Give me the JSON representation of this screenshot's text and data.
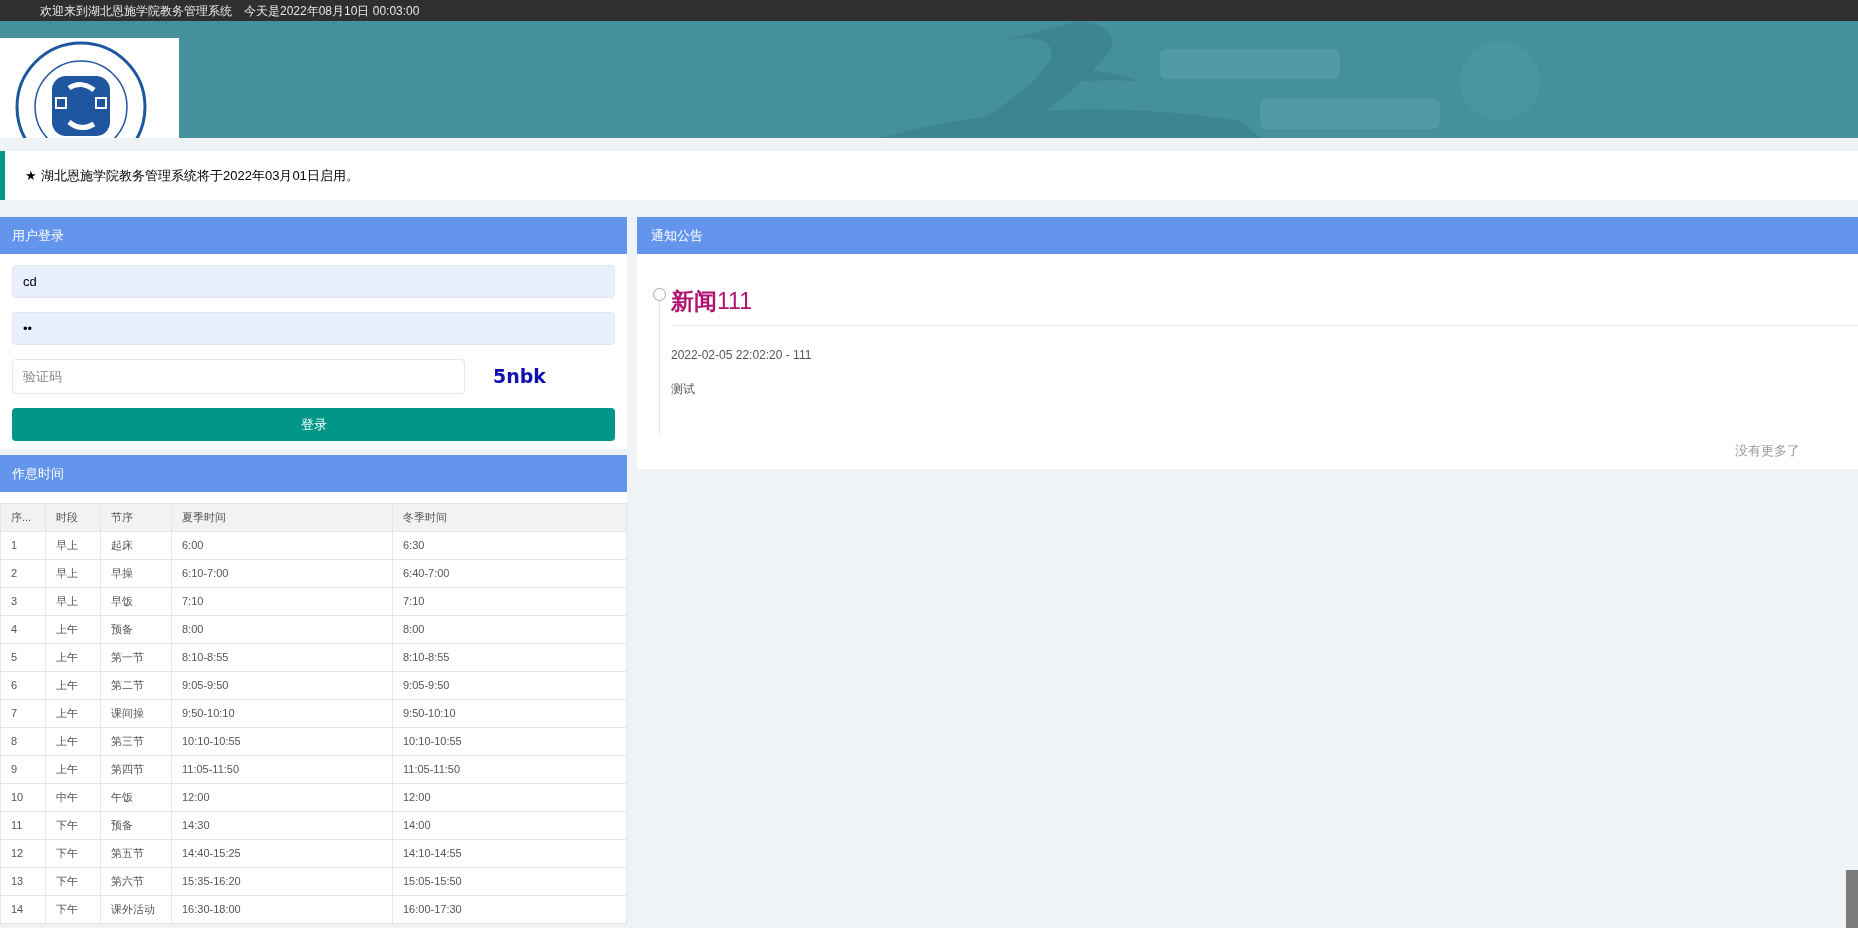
{
  "top_bar": {
    "welcome": "欢迎来到湖北恩施学院教务管理系统",
    "date_text": "今天是2022年08月10日 00:03:00"
  },
  "notice": {
    "icon": "★",
    "text": "湖北恩施学院教务管理系统将于2022年03月01日启用。"
  },
  "login": {
    "title": "用户登录",
    "username": {
      "value": "cd"
    },
    "password": {
      "value": "••"
    },
    "captcha": {
      "placeholder": "验证码",
      "code": "5nbk"
    },
    "button": "登录"
  },
  "schedule": {
    "title": "作息时间",
    "columns": [
      "序...",
      "时段",
      "节序",
      "夏季时间",
      "冬季时间"
    ],
    "rows": [
      [
        "1",
        "早上",
        "起床",
        "6:00",
        "6:30"
      ],
      [
        "2",
        "早上",
        "早操",
        "6:10-7:00",
        "6:40-7:00"
      ],
      [
        "3",
        "早上",
        "早饭",
        "7:10",
        "7:10"
      ],
      [
        "4",
        "上午",
        "预备",
        "8:00",
        "8:00"
      ],
      [
        "5",
        "上午",
        "第一节",
        "8:10-8:55",
        "8:10-8:55"
      ],
      [
        "6",
        "上午",
        "第二节",
        "9:05-9:50",
        "9:05-9:50"
      ],
      [
        "7",
        "上午",
        "课间操",
        "9:50-10:10",
        "9:50-10:10"
      ],
      [
        "8",
        "上午",
        "第三节",
        "10:10-10:55",
        "10:10-10:55"
      ],
      [
        "9",
        "上午",
        "第四节",
        "11:05-11:50",
        "11:05-11:50"
      ],
      [
        "10",
        "中午",
        "午饭",
        "12:00",
        "12:00"
      ],
      [
        "11",
        "下午",
        "预备",
        "14:30",
        "14:00"
      ],
      [
        "12",
        "下午",
        "第五节",
        "14:40-15:25",
        "14:10-14:55"
      ],
      [
        "13",
        "下午",
        "第六节",
        "15:35-16:20",
        "15:05-15:50"
      ],
      [
        "14",
        "下午",
        "课外活动",
        "16:30-18:00",
        "16:00-17:30"
      ]
    ]
  },
  "announcements": {
    "title": "通知公告",
    "items": [
      {
        "title": "**新闻**111",
        "meta": "2022-02-05 22:02:20 - 111",
        "body": "测试"
      }
    ],
    "footer": "没有更多了"
  }
}
